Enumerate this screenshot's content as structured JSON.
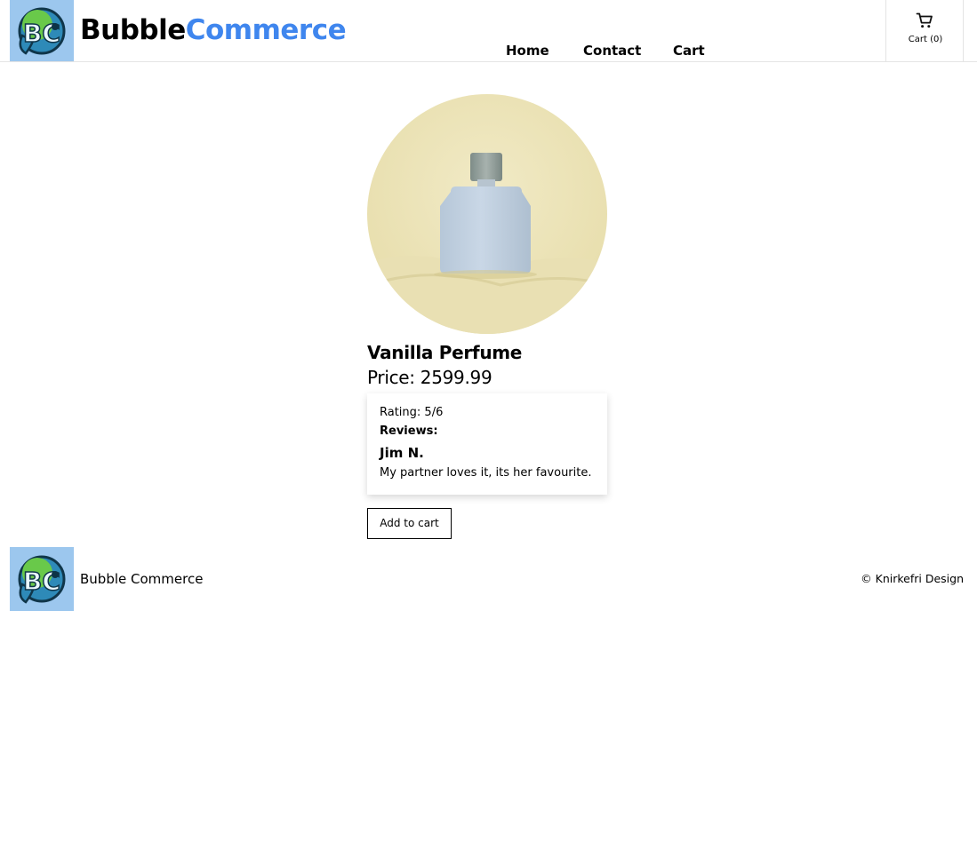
{
  "header": {
    "brand_part1": "Bubble",
    "brand_part2": "Commerce",
    "logo_icon": "bubble-commerce-logo-icon",
    "nav": [
      {
        "label": "Home"
      },
      {
        "label": "Contact"
      },
      {
        "label": "Cart"
      }
    ],
    "cart_widget": {
      "icon": "shopping-cart-icon",
      "label": "Cart (0)"
    }
  },
  "product": {
    "image_icon": "perfume-bottle-image",
    "name": "Vanilla Perfume",
    "price": "Price: 2599.99",
    "rating": "Rating: 5/6",
    "reviews_heading": "Reviews:",
    "reviews": [
      {
        "author": "Jim N.",
        "text": "My partner loves it, its her favourite."
      }
    ],
    "add_to_cart_label": "Add to cart"
  },
  "footer": {
    "name": "Bubble Commerce",
    "copyright": "© Knirkefri Design"
  },
  "colors": {
    "brand_accent": "#3f86ee",
    "logo_background": "#9cc7ee"
  }
}
